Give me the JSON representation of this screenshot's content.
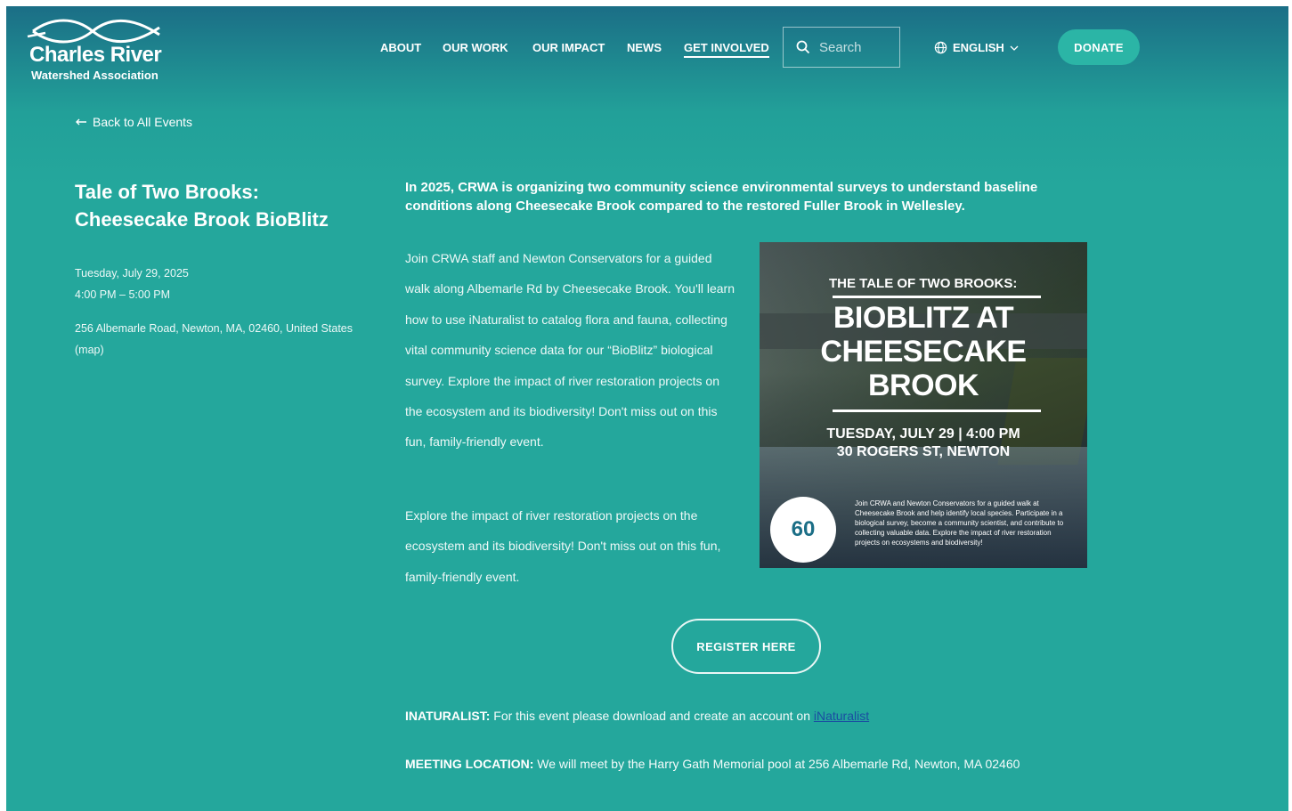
{
  "brand": {
    "name": "Charles River",
    "subtitle": "Watershed Association"
  },
  "nav": {
    "items": [
      {
        "label": "ABOUT"
      },
      {
        "label": "OUR WORK"
      },
      {
        "label": "OUR IMPACT"
      },
      {
        "label": "NEWS"
      },
      {
        "label": "GET INVOLVED"
      }
    ],
    "active_item": "GET INVOLVED",
    "search_placeholder": "Search",
    "language": "ENGLISH",
    "donate_label": "DONATE"
  },
  "back_link": "Back to All Events",
  "event": {
    "title_line1": "Tale of Two Brooks:",
    "title_line2": "Cheesecake Brook BioBlitz",
    "date": "Tuesday, July 29, 2025",
    "time": "4:00 PM – 5:00 PM",
    "address": "256 Albemarle Road, Newton, MA, 02460, United States",
    "map_link": "(map)"
  },
  "content": {
    "lead": "In 2025, CRWA is organizing two community science environmental surveys to understand baseline conditions along Cheesecake Brook compared to the restored Fuller Brook in Wellesley.",
    "paragraph1": "Join CRWA staff and Newton Conservators for a guided walk along Albemarle Rd by Cheesecake Brook. You'll learn how to use iNaturalist to catalog flora and fauna, collecting vital community science data for our “BioBlitz” biological survey. Explore the impact of river restoration projects on the ecosystem and its biodiversity! Don't miss out on this fun, family-friendly event.",
    "paragraph2": "Explore the impact of river restoration projects on the ecosystem and its biodiversity! Don't miss out on this fun, family-friendly event.",
    "register_label": "REGISTER HERE",
    "inaturalist_label": "INATURALIST:",
    "inaturalist_text": "For this event please download and create an account on",
    "inaturalist_link": "iNaturalist",
    "meeting_label": "MEETING LOCATION:",
    "meeting_text": "We will meet by the Harry Gath Memorial pool at  256 Albemarle Rd, Newton, MA 02460"
  },
  "poster": {
    "kicker": "THE TALE OF TWO BROOKS:",
    "line1": "BIOBLITZ AT",
    "line2": "CHEESECAKE",
    "line3": "BROOK",
    "date": "TUESDAY, JULY 29 | 4:00 PM",
    "location": "30 ROGERS ST, NEWTON",
    "badge": "60",
    "description": "Join CRWA and Newton Conservators for a guided walk at Cheesecake Brook and help identify local species. Participate in a biological survey, become a community scientist, and contribute to collecting valuable data. Explore the impact of river restoration projects on ecosystems and biodiversity!"
  },
  "colors": {
    "background": "#24a79c",
    "header_top": "#1b6e86",
    "donate": "#2bb5a6",
    "link": "#1a4ea1"
  }
}
